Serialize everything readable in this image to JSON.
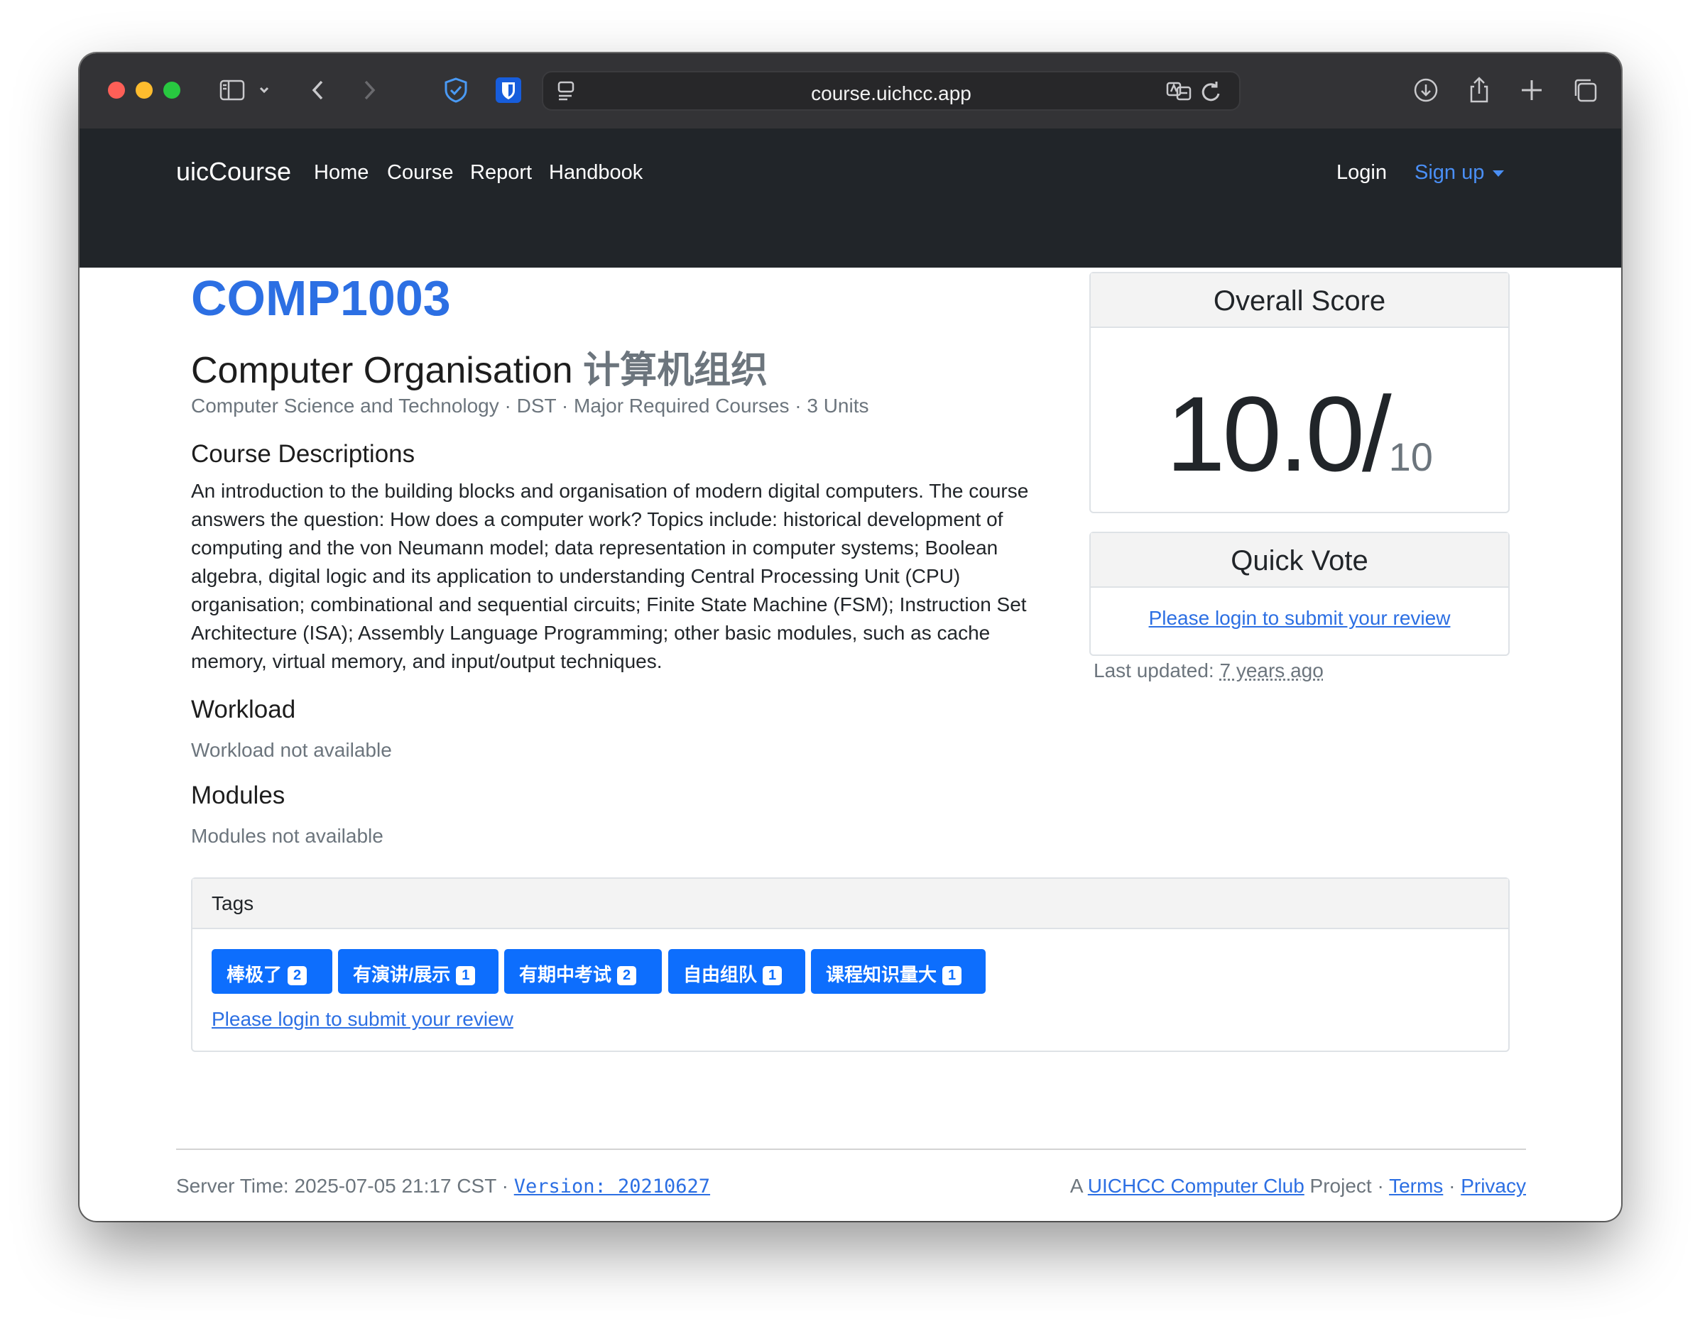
{
  "browser": {
    "url": "course.uichcc.app",
    "traffic_lights": [
      "#fe5f57",
      "#febc2e",
      "#28c840"
    ]
  },
  "navbar": {
    "brand": "uicCourse",
    "links": [
      "Home",
      "Course",
      "Report",
      "Handbook"
    ],
    "login": "Login",
    "signup": "Sign up"
  },
  "course": {
    "code": "COMP1003",
    "title_en": "Computer Organisation",
    "title_cn": "计算机组织",
    "meta": "Computer Science and Technology · DST · Major Required Courses · 3 Units",
    "desc_heading": "Course Descriptions",
    "description": "An introduction to the building blocks and organisation of modern digital computers. The course answers the question: How does a computer work? Topics include: historical development of computing and the von Neumann model; data representation in computer systems; Boolean algebra, digital logic and its application to understanding Central Processing Unit (CPU) organisation; combinational and sequential circuits; Finite State Machine (FSM); Instruction Set Architecture (ISA); Assembly Language Programming; other basic modules, such as cache memory, virtual memory, and input/output techniques.",
    "workload_heading": "Workload",
    "workload_text": "Workload not available",
    "modules_heading": "Modules",
    "modules_text": "Modules not available"
  },
  "overall": {
    "title": "Overall Score",
    "score": "10.0/",
    "max": "10"
  },
  "quick_vote": {
    "title": "Quick Vote",
    "link": "Please login to submit your review",
    "updated_label": "Last updated:",
    "updated_value": "7 years ago"
  },
  "tags": {
    "title": "Tags",
    "items": [
      {
        "label": "棒极了",
        "count": "2"
      },
      {
        "label": "有演讲/展示",
        "count": "1"
      },
      {
        "label": "有期中考试",
        "count": "2"
      },
      {
        "label": "自由组队",
        "count": "1"
      },
      {
        "label": "课程知识量大",
        "count": "1"
      }
    ],
    "login_link": "Please login to submit your review"
  },
  "footer": {
    "server_time": "Server Time: 2025-07-05 21:17 CST ·",
    "version": "Version: 20210627",
    "prefix": "A",
    "club": "UICHCC Computer Club",
    "project": "Project ·",
    "terms": "Terms",
    "dot": "·",
    "privacy": "Privacy"
  }
}
